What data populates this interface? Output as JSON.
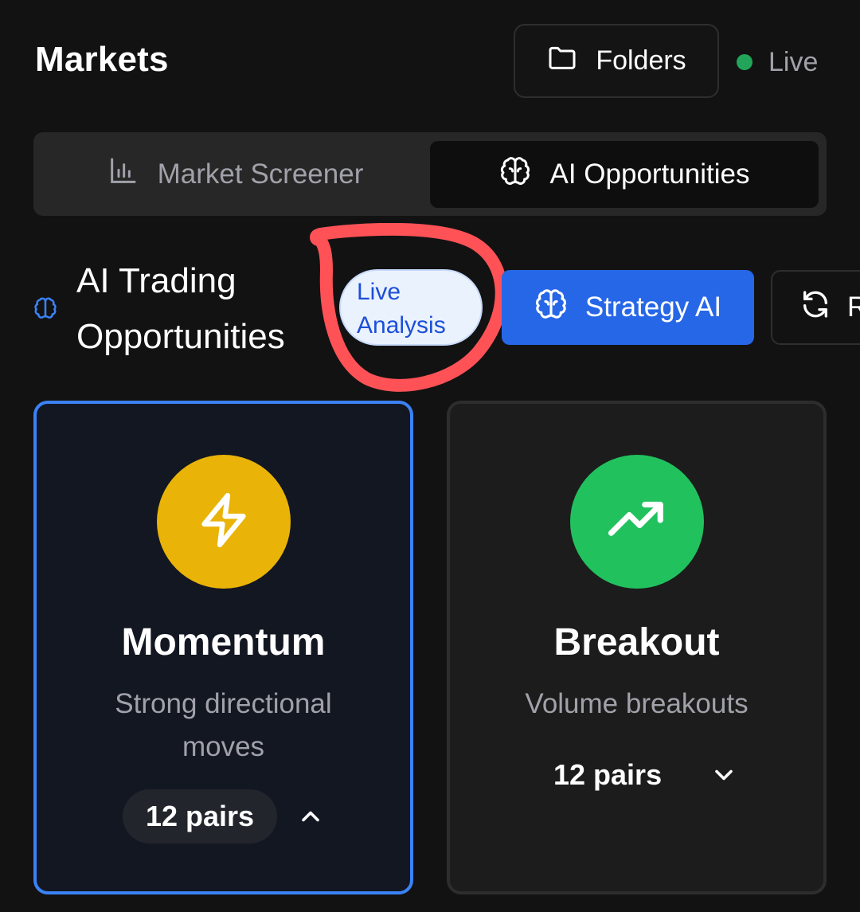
{
  "header": {
    "title": "Markets",
    "folders_label": "Folders",
    "folders_icon": "folder-icon",
    "live_label": "Live",
    "live_color": "#22a55a"
  },
  "tabs": [
    {
      "label": "Market Screener",
      "icon": "bar-chart-icon",
      "active": false
    },
    {
      "label": "AI Opportunities",
      "icon": "brain-icon",
      "active": true
    }
  ],
  "section": {
    "icon": "brain-icon",
    "title": "AI Trading Opportunities",
    "badge": "Live Analysis",
    "strategy_button": "Strategy AI",
    "refresh_button": "R",
    "annotation_color": "#ff5257"
  },
  "cards": [
    {
      "title": "Momentum",
      "description": "Strong directional moves",
      "pairs": "12 pairs",
      "icon": "lightning-icon",
      "icon_color": "#e9b308",
      "selected": true,
      "expanded": true
    },
    {
      "title": "Breakout",
      "description": "Volume breakouts",
      "pairs": "12 pairs",
      "icon": "trending-up-icon",
      "icon_color": "#21c25e",
      "selected": false,
      "expanded": false
    }
  ]
}
